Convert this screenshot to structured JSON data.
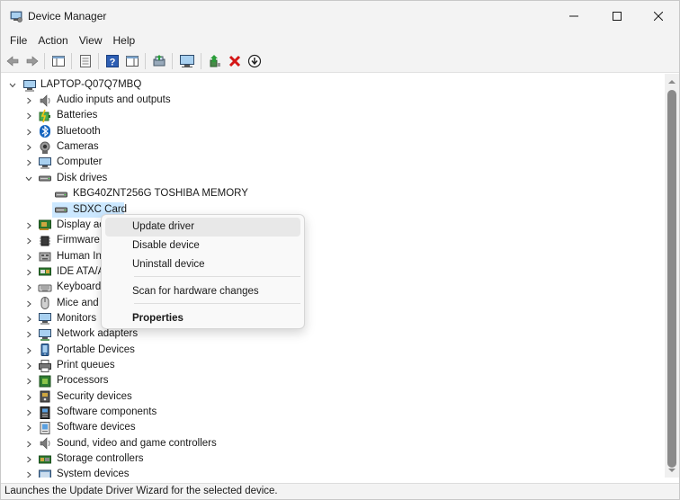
{
  "window": {
    "title": "Device Manager"
  },
  "menubar": {
    "items": [
      "File",
      "Action",
      "View",
      "Help"
    ]
  },
  "tree": {
    "root": "LAPTOP-Q07Q7MBQ",
    "items": [
      {
        "label": "Audio inputs and outputs",
        "icon": "speaker-icon"
      },
      {
        "label": "Batteries",
        "icon": "battery-icon"
      },
      {
        "label": "Bluetooth",
        "icon": "bluetooth-icon"
      },
      {
        "label": "Cameras",
        "icon": "camera-icon"
      },
      {
        "label": "Computer",
        "icon": "monitor-icon"
      },
      {
        "label": "Disk drives",
        "icon": "drive-icon",
        "expanded": true
      },
      {
        "label": "KBG40ZNT256G TOSHIBA MEMORY",
        "icon": "drive-icon",
        "child": true
      },
      {
        "label": "SDXC Card",
        "icon": "drive-icon",
        "child": true,
        "selected": true
      },
      {
        "label": "Display ac",
        "icon": "display-adapter-icon"
      },
      {
        "label": "Firmware",
        "icon": "chip-icon"
      },
      {
        "label": "Human In",
        "icon": "hid-icon"
      },
      {
        "label": "IDE ATA/A",
        "icon": "ide-icon"
      },
      {
        "label": "Keyboard",
        "icon": "keyboard-icon"
      },
      {
        "label": "Mice and",
        "icon": "mouse-icon"
      },
      {
        "label": "Monitors",
        "icon": "monitor-icon"
      },
      {
        "label": "Network adapters",
        "icon": "network-icon"
      },
      {
        "label": "Portable Devices",
        "icon": "portable-device-icon"
      },
      {
        "label": "Print queues",
        "icon": "printer-icon"
      },
      {
        "label": "Processors",
        "icon": "processor-icon"
      },
      {
        "label": "Security devices",
        "icon": "security-icon"
      },
      {
        "label": "Software components",
        "icon": "software-component-icon"
      },
      {
        "label": "Software devices",
        "icon": "software-device-icon"
      },
      {
        "label": "Sound, video and game controllers",
        "icon": "speaker-icon"
      },
      {
        "label": "Storage controllers",
        "icon": "storage-controller-icon"
      },
      {
        "label": "System devices",
        "icon": "system-icon"
      }
    ]
  },
  "context_menu": {
    "items": [
      {
        "label": "Update driver",
        "hover": true
      },
      {
        "label": "Disable device"
      },
      {
        "label": "Uninstall device"
      },
      {
        "label": "Scan for hardware changes"
      },
      {
        "label": "Properties",
        "bold": true
      }
    ]
  },
  "statusbar": {
    "text": "Launches the Update Driver Wizard for the selected device."
  },
  "colors": {
    "selection": "#cce8ff",
    "accent": "#0067c0",
    "uninstall_red": "#d41616"
  }
}
